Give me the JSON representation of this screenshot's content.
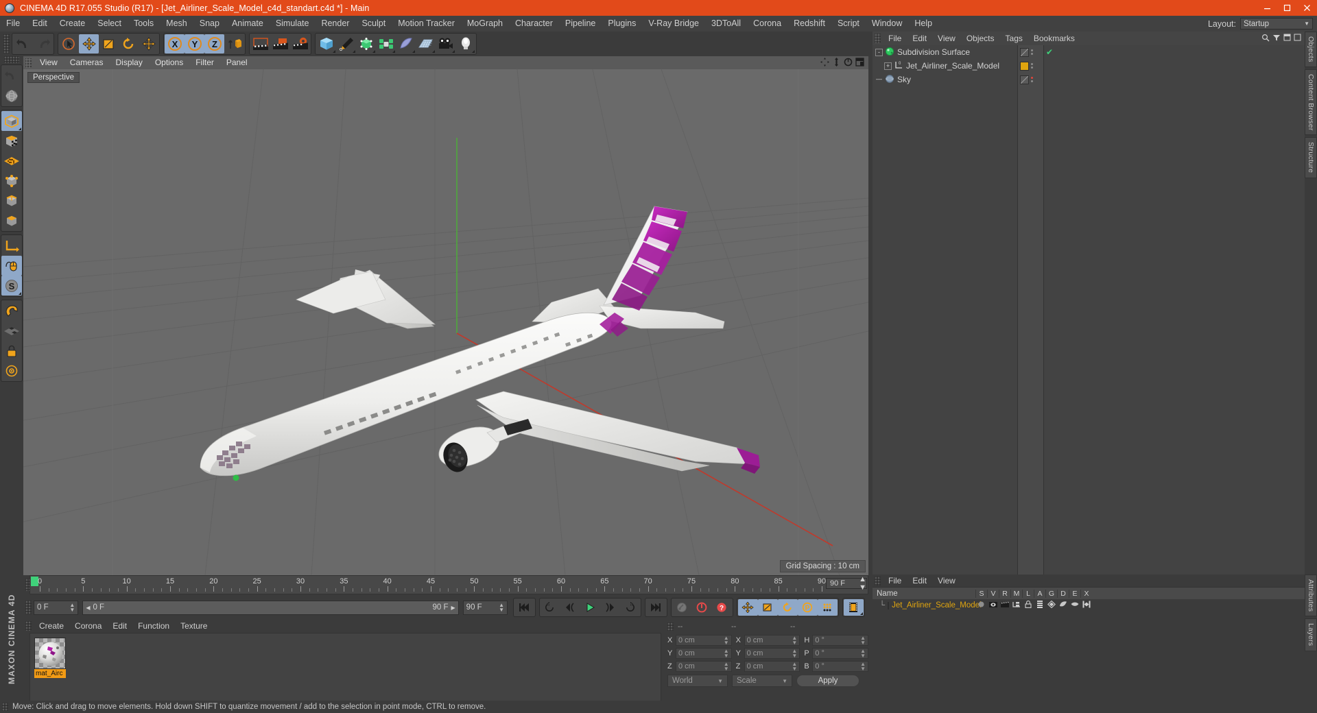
{
  "window": {
    "title": "CINEMA 4D R17.055 Studio (R17) - [Jet_Airliner_Scale_Model_c4d_standart.c4d *] - Main",
    "app_icon": "c4d-sphere-icon",
    "minimize": "minimize-button",
    "maximize": "maximize-button",
    "close": "close-button",
    "accent_color": "#e24a1a"
  },
  "menubar": {
    "items": [
      "File",
      "Edit",
      "Create",
      "Select",
      "Tools",
      "Mesh",
      "Snap",
      "Animate",
      "Simulate",
      "Render",
      "Sculpt",
      "Motion Tracker",
      "MoGraph",
      "Character",
      "Pipeline",
      "Plugins",
      "V-Ray Bridge",
      "3DToAll",
      "Corona",
      "Redshift",
      "Script",
      "Window",
      "Help"
    ],
    "layout_label": "Layout:",
    "layout_value": "Startup"
  },
  "toolbar": {
    "groups": [
      {
        "name": "undo-redo",
        "buttons": [
          {
            "name": "undo-button",
            "icon": "undo-arrow-icon",
            "active": false
          },
          {
            "name": "redo-button",
            "icon": "redo-arrow-icon",
            "active": false
          }
        ]
      },
      {
        "name": "transform-tools",
        "buttons": [
          {
            "name": "live-selection-tool",
            "icon": "cursor-circle-icon",
            "active": false
          },
          {
            "name": "move-tool",
            "icon": "move-arrows-icon",
            "active": true
          },
          {
            "name": "scale-tool",
            "icon": "scale-box-icon",
            "active": false
          },
          {
            "name": "rotate-tool",
            "icon": "rotate-circle-icon",
            "active": false
          },
          {
            "name": "dynamic-place-tool",
            "icon": "move-arrows-icon",
            "active": false
          }
        ]
      },
      {
        "name": "axis-locks",
        "buttons": [
          {
            "name": "lock-x-axis",
            "icon": "letter-x-icon",
            "active": true
          },
          {
            "name": "lock-y-axis",
            "icon": "letter-y-icon",
            "active": true
          },
          {
            "name": "lock-z-axis",
            "icon": "letter-z-icon",
            "active": true
          },
          {
            "name": "world-object-coordinate-toggle",
            "icon": "world-axis-cube-icon",
            "active": false
          }
        ]
      },
      {
        "name": "render-tools",
        "buttons": [
          {
            "name": "render-view-button",
            "icon": "clapperboard-icon",
            "active": false
          },
          {
            "name": "render-to-picture-viewer-button",
            "icon": "clapperboard-picture-icon",
            "active": false
          },
          {
            "name": "render-settings-button",
            "icon": "clapperboard-gear-icon",
            "active": false
          }
        ]
      },
      {
        "name": "object-creation",
        "buttons": [
          {
            "name": "add-cube-button",
            "icon": "cube-icon",
            "active": false
          },
          {
            "name": "add-spline-button",
            "icon": "pen-icon",
            "active": false
          },
          {
            "name": "generators-button",
            "icon": "nurbs-green-icon",
            "active": false
          },
          {
            "name": "mograph-button",
            "icon": "cloner-green-icon",
            "active": false
          },
          {
            "name": "deformer-button",
            "icon": "bend-deformer-icon",
            "active": false
          },
          {
            "name": "scene-environment-button",
            "icon": "floor-grid-icon",
            "active": false
          },
          {
            "name": "camera-button",
            "icon": "camera-icon",
            "active": false
          },
          {
            "name": "light-button",
            "icon": "light-bulb-icon",
            "active": false
          }
        ]
      }
    ]
  },
  "lefttools": {
    "groups": [
      {
        "name": "viewport-nav",
        "buttons": [
          {
            "name": "undo-view-button",
            "icon": "undo-view-icon",
            "active": false
          },
          {
            "name": "viewport-camera-button",
            "icon": "globe-wire-icon",
            "active": false
          }
        ]
      },
      {
        "name": "selection-modes",
        "buttons": [
          {
            "name": "model-mode-button",
            "icon": "model-cube-icon",
            "active": true
          },
          {
            "name": "texture-mode-button",
            "icon": "texture-cube-icon",
            "active": false
          },
          {
            "name": "uv-mode-button",
            "icon": "uv-grid-icon",
            "active": false
          },
          {
            "name": "points-mode-button",
            "icon": "points-cube-icon",
            "active": false
          },
          {
            "name": "edges-mode-button",
            "icon": "edges-cube-icon",
            "active": false
          },
          {
            "name": "polygons-mode-button",
            "icon": "polygons-cube-icon",
            "active": false
          }
        ]
      },
      {
        "name": "axis-enable",
        "buttons": [
          {
            "name": "enable-axis-button",
            "icon": "axis-corner-icon",
            "active": false
          },
          {
            "name": "enable-snapping-button",
            "icon": "mouse-icon",
            "active": true
          },
          {
            "name": "world-axis-button",
            "icon": "letter-s-circle-icon",
            "active": true
          }
        ]
      },
      {
        "name": "magnet-tools",
        "buttons": [
          {
            "name": "magnet-tool-button",
            "icon": "magnet-icon",
            "active": false
          },
          {
            "name": "workplane-button",
            "icon": "checker-plane-icon",
            "active": false
          },
          {
            "name": "lock-workplane-button",
            "icon": "lock-icon",
            "active": false
          },
          {
            "name": "workplane-options-button",
            "icon": "target-icon",
            "active": false
          }
        ]
      }
    ],
    "brand": "MAXON CINEMA 4D"
  },
  "viewport": {
    "menu_items": [
      "View",
      "Cameras",
      "Display",
      "Options",
      "Filter",
      "Panel"
    ],
    "corner_icons": [
      "pan-view-icon",
      "zoom-view-icon",
      "rotate-view-icon",
      "maximize-view-icon"
    ],
    "label": "Perspective",
    "grid_spacing": "Grid Spacing : 10 cm",
    "scene": {
      "model": "Jet Airliner Scale Model",
      "body_color": "#e8e8e6",
      "accent_color": "#a61f9e",
      "background_color": "#6a6a6a"
    }
  },
  "object_manager": {
    "menu": [
      "File",
      "Edit",
      "View",
      "Objects",
      "Tags",
      "Bookmarks"
    ],
    "right_icons": [
      "search-icon",
      "filter-icon",
      "minimize-panel-icon",
      "maximize-panel-icon"
    ],
    "rows": [
      {
        "name": "Subdivision Surface",
        "icon": "subdivision-surface-icon",
        "depth": 0,
        "expander": "-",
        "swatch": "none",
        "check": "green-check"
      },
      {
        "name": "Jet_Airliner_Scale_Model",
        "icon": "null-object-icon",
        "depth": 1,
        "expander": "+",
        "swatch": "#e0a50f",
        "check": "none"
      },
      {
        "name": "Sky",
        "icon": "sky-object-icon",
        "depth": 0,
        "expander": "none",
        "swatch": "none",
        "check": "red-dot"
      }
    ]
  },
  "edge_tabs_right": [
    "Objects",
    "Content Browser",
    "Structure"
  ],
  "edge_tabs_right_bottom": [
    "Attributes",
    "Layers"
  ],
  "timeline": {
    "ticks": [
      0,
      5,
      10,
      15,
      20,
      25,
      30,
      35,
      40,
      45,
      50,
      55,
      60,
      65,
      70,
      75,
      80,
      85,
      90
    ],
    "end_field": "90 F",
    "current_frame_marker": 0
  },
  "transport": {
    "current_frame": "0 F",
    "range_start": "0 F",
    "range_end": "90 F",
    "preview_end": "90 F",
    "buttons": [
      {
        "name": "go-to-start-button",
        "icon": "skip-start-icon"
      },
      {
        "name": "play-reverse-button",
        "icon": "rewind-loop-icon"
      },
      {
        "name": "previous-frame-button",
        "icon": "step-back-icon"
      },
      {
        "name": "play-button",
        "icon": "play-triangle-icon"
      },
      {
        "name": "next-frame-button",
        "icon": "step-forward-icon"
      },
      {
        "name": "play-forward-loop-button",
        "icon": "forward-loop-icon"
      },
      {
        "name": "go-to-end-button",
        "icon": "skip-end-icon"
      },
      {
        "name": "record-active-objects-button",
        "icon": "key-gray-icon"
      },
      {
        "name": "autokeying-button",
        "icon": "autokey-red-icon"
      },
      {
        "name": "keyframe-selection-button",
        "icon": "question-red-icon"
      },
      {
        "name": "position-key-button",
        "icon": "move-arrows-icon"
      },
      {
        "name": "scale-key-button",
        "icon": "scale-box-icon"
      },
      {
        "name": "rotation-key-button",
        "icon": "rotate-circle-icon"
      },
      {
        "name": "parameter-key-button",
        "icon": "letter-p-circle-icon"
      },
      {
        "name": "point-level-animation-button",
        "icon": "dots-grid-icon"
      },
      {
        "name": "timeline-button",
        "icon": "film-strip-icon"
      }
    ]
  },
  "material_manager": {
    "menu": [
      "Create",
      "Corona",
      "Edit",
      "Function",
      "Texture"
    ],
    "materials": [
      {
        "name": "mat_Airc",
        "full_name": "mat_Aircraft",
        "selected": true,
        "base_color": "#e6e4e2",
        "accent_color": "#b21fa8"
      }
    ]
  },
  "coordinates": {
    "headers": [
      "--",
      "--",
      "--"
    ],
    "rows": [
      {
        "label1": "X",
        "value1": "0 cm",
        "label2": "X",
        "value2": "0 cm",
        "label3": "H",
        "value3": "0 °"
      },
      {
        "label1": "Y",
        "value1": "0 cm",
        "label2": "Y",
        "value2": "0 cm",
        "label3": "P",
        "value3": "0 °"
      },
      {
        "label1": "Z",
        "value1": "0 cm",
        "label2": "Z",
        "value2": "0 cm",
        "label3": "B",
        "value3": "0 °"
      }
    ],
    "system_select": "World",
    "mode_select": "Scale",
    "apply_label": "Apply"
  },
  "layer_manager": {
    "menu": [
      "File",
      "Edit",
      "View"
    ],
    "name_header": "Name",
    "columns": [
      "S",
      "V",
      "R",
      "M",
      "L",
      "A",
      "G",
      "D",
      "E",
      "X"
    ],
    "rows": [
      {
        "name": "Jet_Airliner_Scale_Model",
        "swatch": "#e0a50f",
        "text_color": "#e0a50f"
      }
    ]
  },
  "statusbar": {
    "text": "Move: Click and drag to move elements. Hold down SHIFT to quantize movement / add to the selection in point mode, CTRL to remove."
  }
}
